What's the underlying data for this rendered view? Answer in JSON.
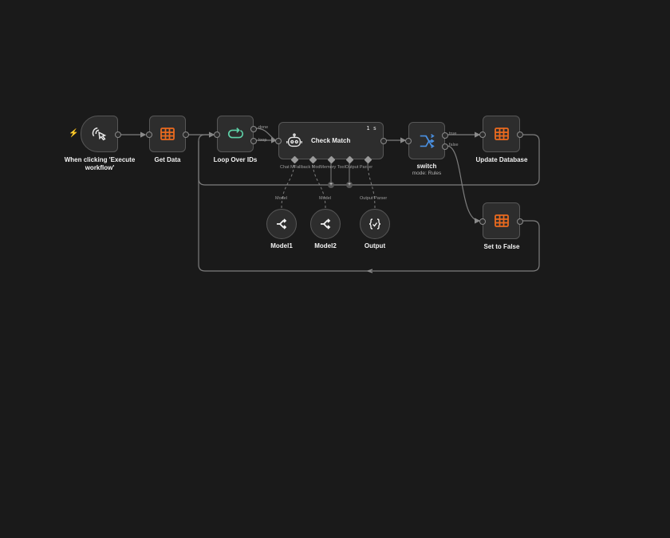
{
  "colors": {
    "background": "#1a1a1a",
    "node_fill": "#2d2d2d",
    "node_border": "#575757",
    "edge": "#7d7d7d",
    "table_icon": "#ea6a1f",
    "loop_icon": "#5fd3a9",
    "switch_icon": "#4a90e2",
    "trigger_bolt": "#f07b24"
  },
  "nodes": {
    "trigger": {
      "label": "When clicking 'Execute workflow'",
      "icon": "cursor-click-icon"
    },
    "get_data": {
      "label": "Get Data",
      "icon": "table-icon"
    },
    "loop": {
      "label": "Loop Over IDs",
      "icon": "loop-icon",
      "out_done": "done",
      "out_loop": "loop"
    },
    "check_match": {
      "label": "Check Match",
      "icon": "robot-icon",
      "exec_badge": "1 s",
      "sub_ports": [
        "Chat Model",
        "Fallback Model",
        "Memory",
        "Tool",
        "Output Parser"
      ],
      "sub_port_display": "Chat MFallback ModMemory  ToolOutput Parser"
    },
    "switch": {
      "label": "switch",
      "subtitle": "mode: Rules",
      "icon": "switch-icon",
      "out_true": "true",
      "out_false": "false"
    },
    "update_db": {
      "label": "Update Database",
      "icon": "table-icon"
    },
    "set_false": {
      "label": "Set to False",
      "icon": "table-icon"
    },
    "model1": {
      "label": "Model1",
      "port_label": "Model",
      "icon": "openrouter-icon"
    },
    "model2": {
      "label": "Model2",
      "port_label": "Model",
      "icon": "openrouter-icon"
    },
    "output": {
      "label": "Output",
      "port_label": "Output Parser",
      "icon": "output-parser-icon"
    }
  }
}
